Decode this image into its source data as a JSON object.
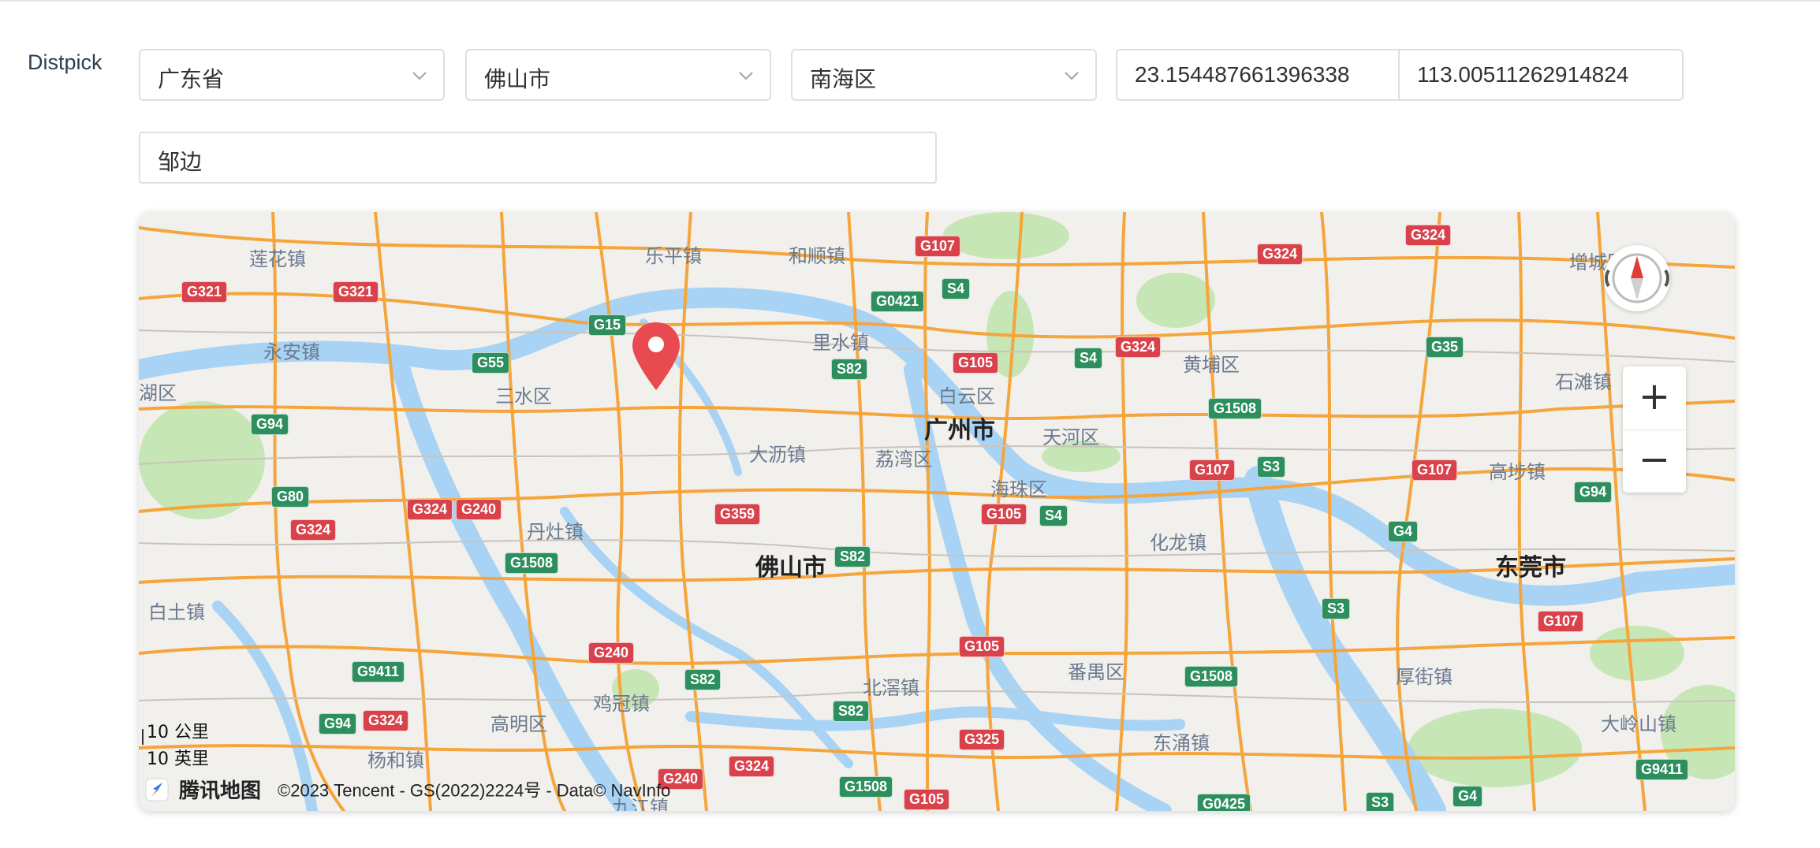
{
  "form": {
    "label": "Distpick",
    "province": "广东省",
    "city": "佛山市",
    "district": "南海区",
    "latitude": "23.154487661396338",
    "longitude": "113.00511262914824",
    "address": "邹边"
  },
  "map": {
    "places_major": [
      "广州市",
      "佛山市",
      "东莞市"
    ],
    "places": [
      "莲花镇",
      "乐平镇",
      "和顺镇",
      "增城区",
      "永安镇",
      "里水镇",
      "白云区",
      "黄埔区",
      "石滩镇",
      "湖区",
      "三水区",
      "天河区",
      "大沥镇",
      "荔湾区",
      "海珠区",
      "高埗镇",
      "丹灶镇",
      "化龙镇",
      "白土镇",
      "北滘镇",
      "番禺区",
      "厚街镇",
      "鸡冠镇",
      "高明区",
      "杨和镇",
      "东涌镇",
      "大岭山镇",
      "九江镇"
    ],
    "road_shields": {
      "red": [
        "G107",
        "G324",
        "G324",
        "G321",
        "G321",
        "G105",
        "G324",
        "G107",
        "G107",
        "G324",
        "G240",
        "G359",
        "G105",
        "G324",
        "G105",
        "G240",
        "G324",
        "G325",
        "G240",
        "G324",
        "G105",
        "G107"
      ],
      "green": [
        "G15",
        "S4",
        "G0421",
        "G55",
        "S82",
        "S4",
        "G35",
        "G1508",
        "G94",
        "S3",
        "G80",
        "S4",
        "G4",
        "G94",
        "G1508",
        "S82",
        "S3",
        "G9411",
        "S82",
        "G1508",
        "S82",
        "G94",
        "G1508",
        "G0425",
        "S3",
        "G4",
        "G9411"
      ]
    },
    "zoom_in_label": "+",
    "zoom_out_label": "−",
    "scale_km": "10 公里",
    "scale_mi": "10 英里",
    "logo_text": "腾讯地图",
    "copyright": "©2023 Tencent - GS(2022)2224号 - Data© NavInfo",
    "colors": {
      "water": "#a9d3f5",
      "park": "#c7e6b5",
      "road_orange": "#f5a53c",
      "shield_red": "#d9424b",
      "shield_green": "#2e8f5e",
      "marker": "#e84a4f"
    },
    "icons": [
      "compass-icon",
      "location-pin-icon",
      "tencent-map-logo-icon"
    ]
  }
}
